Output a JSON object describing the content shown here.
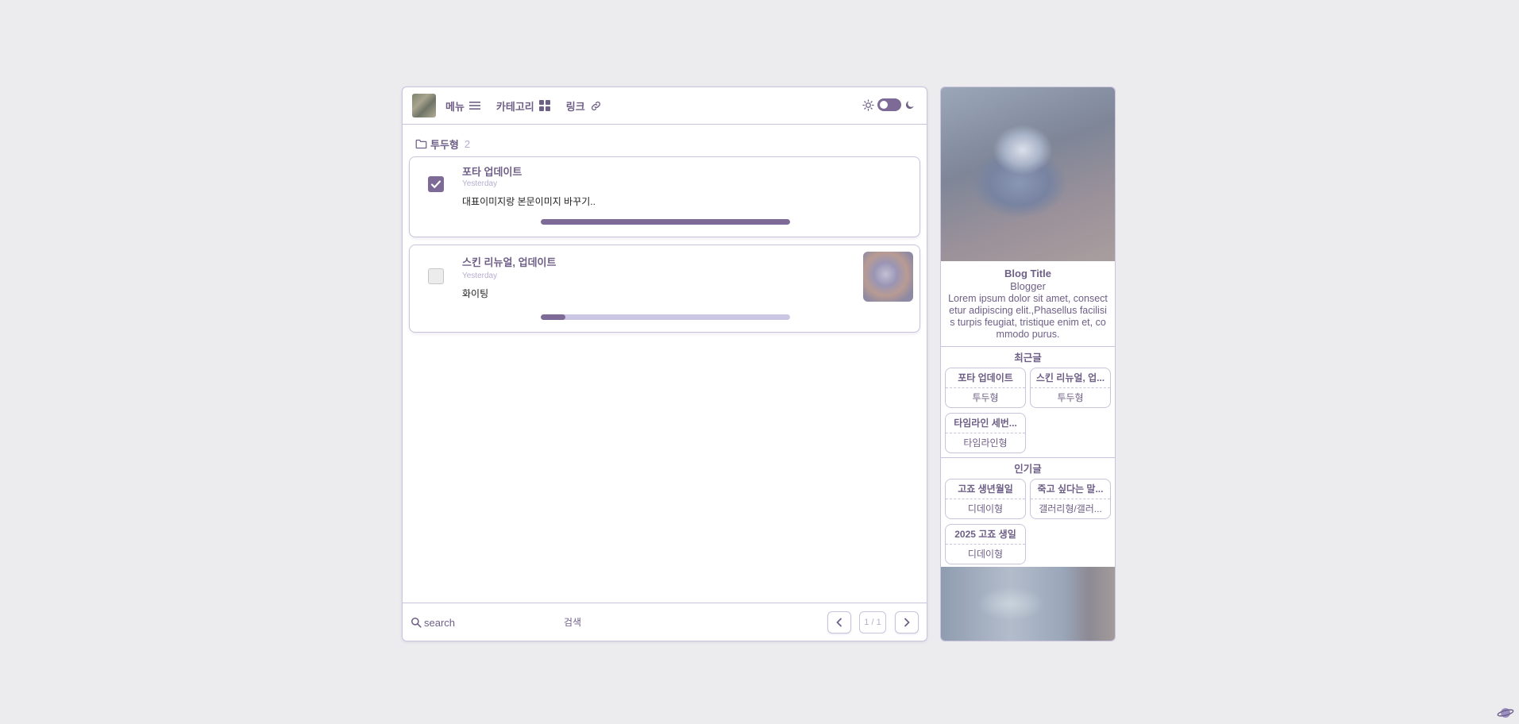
{
  "header": {
    "menu_label": "메뉴",
    "category_label": "카테고리",
    "link_label": "링크"
  },
  "folder": {
    "name": "투두형",
    "count": "2"
  },
  "todos": [
    {
      "title": "포타 업데이트",
      "date": "Yesterday",
      "desc": "대표이미지랑 본문이미지 바꾸기..",
      "checked": true,
      "progress": 1.0
    },
    {
      "title": "스킨 리뉴얼, 업데이트",
      "date": "Yesterday",
      "desc": "화이팅",
      "checked": false,
      "progress": 0.1
    }
  ],
  "footer": {
    "search_placeholder": "search",
    "search_button": "검색",
    "pager": "1 / 1"
  },
  "sidebar": {
    "blog_title": "Blog Title",
    "role": "Blogger",
    "description": "Lorem ipsum dolor sit amet, consectetur adipiscing elit.,Phasellus facilisis turpis feugiat, tristique enim et, commodo purus.",
    "recent": {
      "title": "최근글",
      "posts": [
        {
          "title": "포타 업데이트",
          "category": "투두형"
        },
        {
          "title": "스킨 리뉴얼, 업...",
          "category": "투두형"
        },
        {
          "title": "타임라인 세번...",
          "category": "타임라인형"
        }
      ]
    },
    "popular": {
      "title": "인기글",
      "posts": [
        {
          "title": "고죠 생년월일",
          "category": "디데이형"
        },
        {
          "title": "죽고 싶다는 말...",
          "category": "갤러리형/갤러..."
        },
        {
          "title": "2025 고죠 생일",
          "category": "디데이형"
        }
      ]
    }
  },
  "colors": {
    "accent": "#7d6a96",
    "text": "#6e5f86",
    "border": "#c9c4dc",
    "muted": "#b6aed0",
    "background": "#ecebee"
  }
}
